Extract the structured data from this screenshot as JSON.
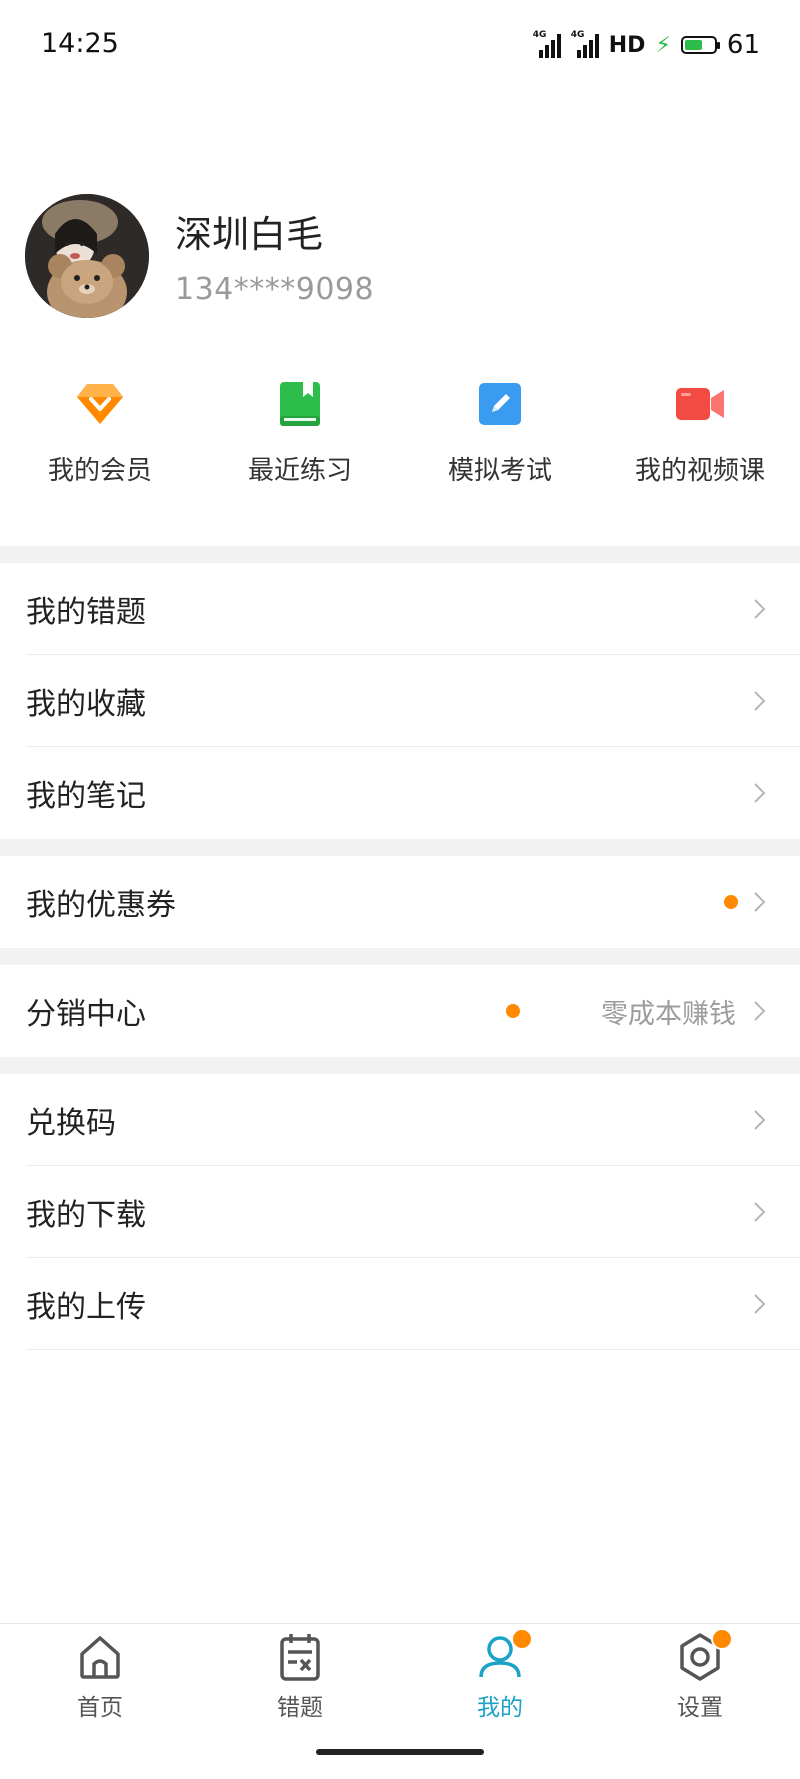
{
  "status_bar": {
    "time": "14:25",
    "net1": "4G",
    "net2": "4G",
    "hd": "HD",
    "battery": "61",
    "battery_level": 0.61
  },
  "profile": {
    "name": "深圳白毛",
    "phone": "134****9098"
  },
  "quick_actions": [
    {
      "label": "我的会员",
      "icon": "diamond-icon",
      "color": "#ff8a00"
    },
    {
      "label": "最近练习",
      "icon": "book-icon",
      "color": "#2dbd4b"
    },
    {
      "label": "模拟考试",
      "icon": "pencil-icon",
      "color": "#3a9cf0"
    },
    {
      "label": "我的视频课",
      "icon": "video-camera-icon",
      "color": "#f24b43"
    }
  ],
  "menu": {
    "group1": [
      "我的错题",
      "我的收藏",
      "我的笔记"
    ],
    "coupons": {
      "label": "我的优惠券"
    },
    "distribution": {
      "label": "分销中心",
      "promo": "零成本赚钱"
    },
    "group4": [
      "兑换码",
      "我的下载",
      "我的上传"
    ]
  },
  "tabbar": [
    {
      "label": "首页",
      "icon": "home-icon"
    },
    {
      "label": "错题",
      "icon": "wrong-questions-icon"
    },
    {
      "label": "我的",
      "icon": "user-icon",
      "active": true
    },
    {
      "label": "设置",
      "icon": "gear-icon"
    }
  ],
  "colors": {
    "accent": "#1aa3c6",
    "badge": "#ff8a00",
    "divider": "#f2f2f2"
  }
}
